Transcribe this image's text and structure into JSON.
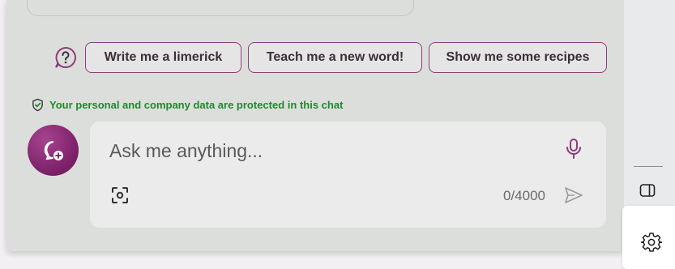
{
  "suggestions": {
    "items": [
      {
        "label": "Write me a limerick"
      },
      {
        "label": "Teach me a new word!"
      },
      {
        "label": "Show me some recipes"
      }
    ]
  },
  "privacy": {
    "message": "Your personal and company data are protected in this chat"
  },
  "composer": {
    "placeholder": "Ask me anything...",
    "char_count": "0/4000"
  },
  "icons": {
    "help": "help-question-icon",
    "shield": "shield-check-icon",
    "new_topic": "new-chat-icon",
    "mic": "microphone-icon",
    "screenshot": "screenshot-capture-icon",
    "send": "send-icon",
    "panel": "sidebar-toggle-icon",
    "settings": "gear-icon"
  },
  "colors": {
    "accent": "#8a3f78",
    "protected_text": "#1e8a2a",
    "new_topic_button": "#7a1f67",
    "panel_bg": "#dcdedc"
  }
}
